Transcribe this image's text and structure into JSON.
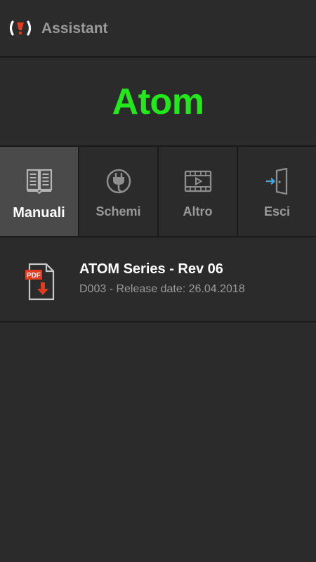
{
  "header": {
    "app_name": "Assistant",
    "logo_icon": "brand-logo-icon"
  },
  "product": {
    "title": "Atom",
    "title_color": "#22e81c"
  },
  "tabs": [
    {
      "label": "Manuali",
      "icon": "book-icon",
      "active": true
    },
    {
      "label": "Schemi",
      "icon": "plug-icon",
      "active": false
    },
    {
      "label": "Altro",
      "icon": "video-icon",
      "active": false
    },
    {
      "label": "Esci",
      "icon": "exit-door-icon",
      "active": false
    }
  ],
  "manuals": [
    {
      "title": "ATOM Series - Rev 06",
      "subtitle": "D003 - Release date: 26.04.2018",
      "icon": "pdf-download-icon",
      "icon_badge": "PDF"
    }
  ],
  "colors": {
    "background": "#2b2b2b",
    "active_tab": "#4a4a4a",
    "accent_red": "#e23b1f",
    "divider": "#1a1a1a"
  }
}
